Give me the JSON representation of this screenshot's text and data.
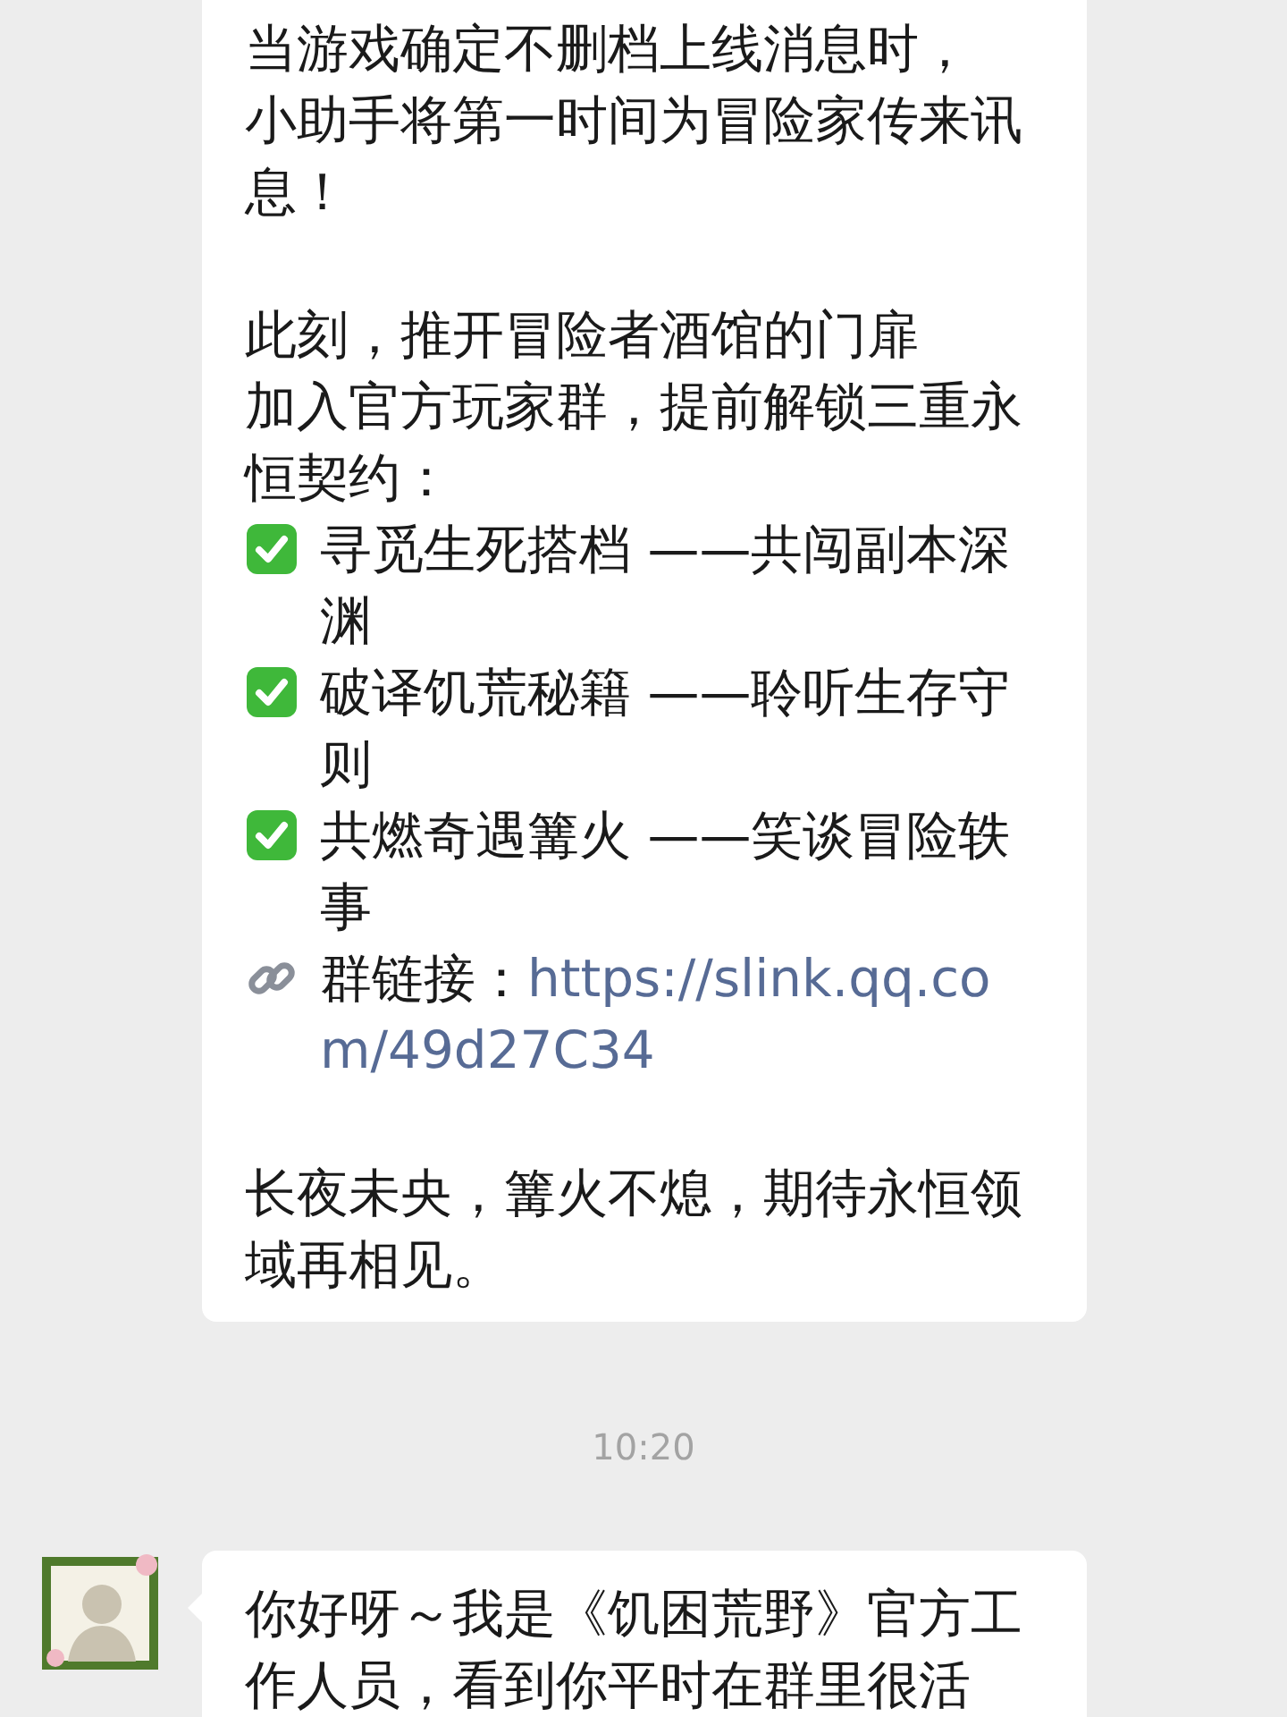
{
  "messages": [
    {
      "kind": "incoming",
      "show_avatar": false,
      "sections": [
        [
          {
            "kind": "text",
            "text": "当游戏确定不删档上线消息时，"
          },
          {
            "kind": "text",
            "text": "小助手将第一时间为冒险家传来讯息！"
          }
        ],
        [
          {
            "kind": "text",
            "text": " 此刻，推开冒险者酒馆的门扉"
          },
          {
            "kind": "text",
            "text": "加入官方玩家群，提前解锁三重永恒契约："
          },
          {
            "kind": "check",
            "text": "寻觅生死搭档 ——共闯副本深渊"
          },
          {
            "kind": "check",
            "text": "破译饥荒秘籍 ——聆听生存守则"
          },
          {
            "kind": "check",
            "text": "共燃奇遇篝火 ——笑谈冒险轶事"
          },
          {
            "kind": "link",
            "text": "群链接：",
            "link": "https://slink.qq.com/49d27C34"
          }
        ],
        [
          {
            "kind": "text",
            "text": " 长夜未央，篝火不熄，期待永恒领域再相见。"
          }
        ]
      ]
    },
    {
      "kind": "time",
      "text": "10:20"
    },
    {
      "kind": "incoming",
      "show_avatar": true,
      "sections": [
        [
          {
            "kind": "text",
            "text": "你好呀～我是《饥困荒野》官方工作人员，看到你平时在群里很活"
          }
        ]
      ]
    }
  ]
}
